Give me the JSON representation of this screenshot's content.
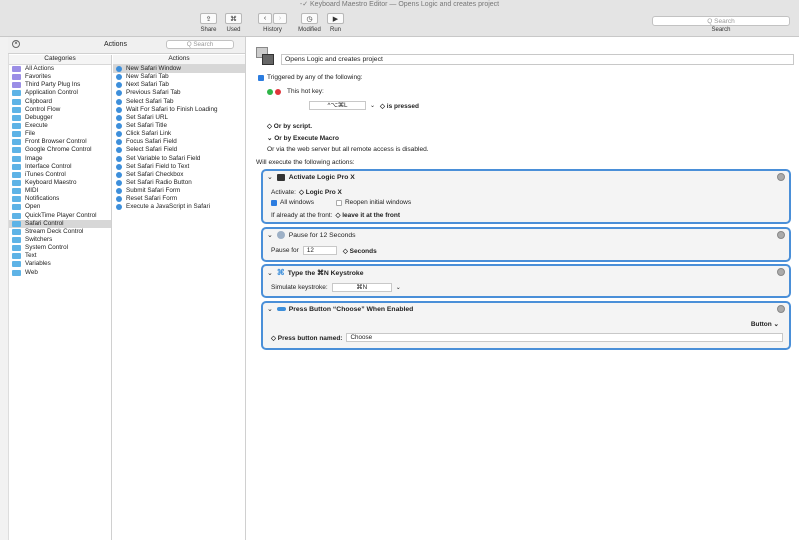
{
  "window": {
    "title": "-✓ Keyboard Maestro Editor — Opens Logic and creates project"
  },
  "toolbar": {
    "share_label": "Share",
    "used_label": "Used",
    "history_label": "History",
    "modified_label": "Modified",
    "run_label": "Run",
    "search_placeholder": "Q Search",
    "search_label": "Search"
  },
  "panel": {
    "title": "Actions",
    "search_placeholder": "Q Search"
  },
  "categories": {
    "header": "Categories",
    "items": [
      {
        "label": "All Actions",
        "color": "purple"
      },
      {
        "label": "Favorites",
        "color": "purple"
      },
      {
        "label": "Third Party Plug Ins",
        "color": "purple"
      },
      {
        "label": "Application Control",
        "color": "blue"
      },
      {
        "label": "Clipboard",
        "color": "blue"
      },
      {
        "label": "Control Flow",
        "color": "blue"
      },
      {
        "label": "Debugger",
        "color": "blue"
      },
      {
        "label": "Execute",
        "color": "blue"
      },
      {
        "label": "File",
        "color": "blue"
      },
      {
        "label": "Front Browser Control",
        "color": "blue"
      },
      {
        "label": "Google Chrome Control",
        "color": "blue"
      },
      {
        "label": "Image",
        "color": "blue"
      },
      {
        "label": "Interface Control",
        "color": "blue"
      },
      {
        "label": "iTunes Control",
        "color": "blue"
      },
      {
        "label": "Keyboard Maestro",
        "color": "blue"
      },
      {
        "label": "MIDI",
        "color": "blue"
      },
      {
        "label": "Notifications",
        "color": "blue"
      },
      {
        "label": "Open",
        "color": "blue"
      },
      {
        "label": "QuickTime Player Control",
        "color": "blue"
      },
      {
        "label": "Safari Control",
        "color": "blue",
        "selected": true
      },
      {
        "label": "Stream Deck Control",
        "color": "blue"
      },
      {
        "label": "Switchers",
        "color": "blue"
      },
      {
        "label": "System Control",
        "color": "blue"
      },
      {
        "label": "Text",
        "color": "blue"
      },
      {
        "label": "Variables",
        "color": "blue"
      },
      {
        "label": "Web",
        "color": "blue"
      }
    ]
  },
  "actions": {
    "header": "Actions",
    "items": [
      {
        "label": "New Safari Window",
        "selected": true
      },
      {
        "label": "New Safari Tab"
      },
      {
        "label": "Next Safari Tab"
      },
      {
        "label": "Previous Safari Tab"
      },
      {
        "label": "Select Safari Tab"
      },
      {
        "label": "Wait For Safari to Finish Loading"
      },
      {
        "label": "Set Safari URL"
      },
      {
        "label": "Set Safari Title"
      },
      {
        "label": "Click Safari Link"
      },
      {
        "label": "Focus Safari Field"
      },
      {
        "label": "Select Safari Field"
      },
      {
        "label": "Set Variable to Safari Field"
      },
      {
        "label": "Set Safari Field to Text"
      },
      {
        "label": "Set Safari Checkbox"
      },
      {
        "label": "Set Safari Radio Button"
      },
      {
        "label": "Submit Safari Form"
      },
      {
        "label": "Reset Safari Form"
      },
      {
        "label": "Execute a JavaScript in Safari"
      }
    ]
  },
  "macro": {
    "name": "Opens Logic and creates project",
    "triggered_label": "Triggered by any of the following:",
    "hotkey_label": "This hot key:",
    "hotkey_value": "^⌥⌘L",
    "is_pressed": "◇ is pressed",
    "or_script": "◇ Or by script.",
    "or_execute": "⌄ Or by Execute Macro",
    "web_server": "Or via the web server but all remote access is disabled.",
    "will_execute": "Will execute the following actions:"
  },
  "action1": {
    "title": "Activate Logic Pro X",
    "activate_label": "Activate:",
    "activate_value": "◇ Logic Pro X",
    "all_windows": "All windows",
    "reopen": "Reopen initial windows",
    "if_front_label": "If already at the front:",
    "if_front_value": "◇ leave it at the front"
  },
  "action2": {
    "title": "Pause for 12 Seconds",
    "pause_label": "Pause for",
    "pause_value": "12",
    "unit": "◇ Seconds"
  },
  "action3": {
    "title": "Type the ⌘N Keystroke",
    "simulate_label": "Simulate keystroke:",
    "key_value": "⌘N"
  },
  "action4": {
    "title": "Press Button “Choose” When Enabled",
    "button_type": "Button ⌄",
    "press_label": "◇ Press button named:",
    "press_value": "Choose"
  }
}
